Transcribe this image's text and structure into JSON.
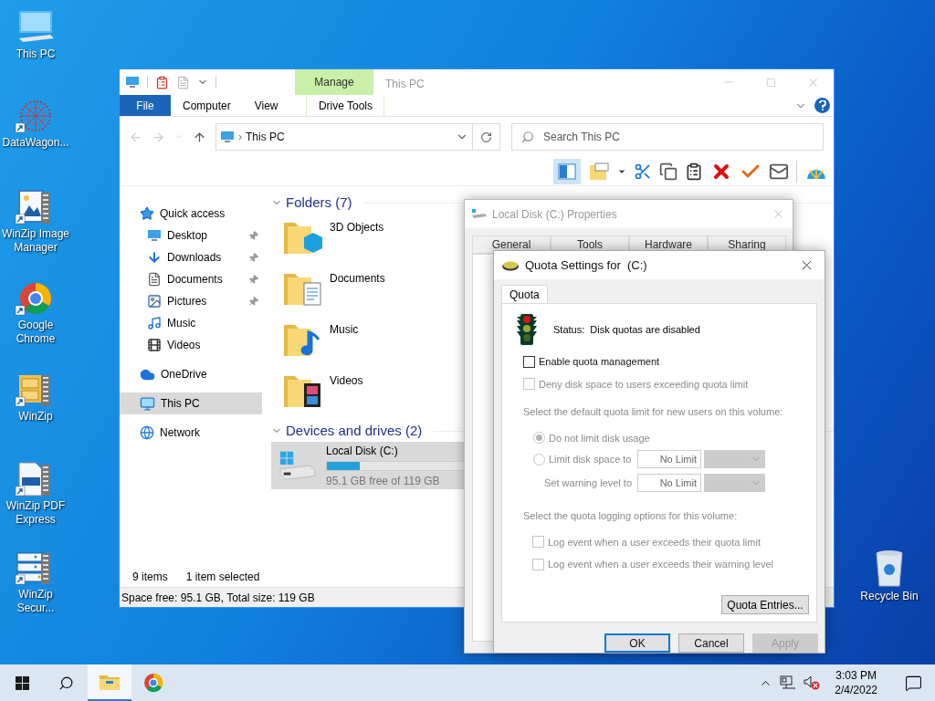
{
  "desktop_icons": [
    {
      "label": "This PC"
    },
    {
      "label": "DataWagon..."
    },
    {
      "label": "WinZip Image Manager"
    },
    {
      "label": "Google Chrome"
    },
    {
      "label": "WinZip"
    },
    {
      "label": "WinZip PDF Express"
    },
    {
      "label": "WinZip Secur..."
    }
  ],
  "recycle_bin": {
    "label": "Recycle Bin"
  },
  "explorer": {
    "title": "This PC",
    "ribbon_group": "Manage",
    "tabs": [
      {
        "label": "File",
        "selected": false
      },
      {
        "label": "Computer",
        "selected": false
      },
      {
        "label": "View",
        "selected": false
      },
      {
        "label": "Drive Tools",
        "selected": false
      }
    ],
    "address": "This PC",
    "address_separator": "›",
    "search": {
      "placeholder": "Search This PC"
    },
    "nav": [
      {
        "label": "Quick access",
        "selected": false,
        "children": [
          {
            "label": "Desktop",
            "pinned": true
          },
          {
            "label": "Downloads",
            "pinned": true
          },
          {
            "label": "Documents",
            "pinned": true
          },
          {
            "label": "Pictures",
            "pinned": true
          },
          {
            "label": "Music",
            "pinned": false
          },
          {
            "label": "Videos",
            "pinned": false
          }
        ]
      },
      {
        "label": "OneDrive",
        "selected": false
      },
      {
        "label": "This PC",
        "selected": true
      },
      {
        "label": "Network",
        "selected": false
      }
    ],
    "folders": {
      "heading": "Folders (7)",
      "items": [
        {
          "label": "3D Objects"
        },
        {
          "label": "Documents"
        },
        {
          "label": "Music"
        },
        {
          "label": "Videos"
        }
      ]
    },
    "drives": {
      "heading": "Devices and drives (2)",
      "items": [
        {
          "label": "Local Disk (C:)",
          "level": 0.2,
          "free": "95.1 GB free of 119 GB",
          "selected": true
        }
      ]
    },
    "status": {
      "count": "9 items",
      "selection": "1 item selected"
    },
    "details_bar": "Space free: 95.1 GB, Total size: 119 GB"
  },
  "properties": {
    "title": "Local Disk (C:) Properties",
    "tabs": [
      "General",
      "Tools",
      "Hardware",
      "Sharing"
    ]
  },
  "quota": {
    "title": "Quota Settings for  (C:)",
    "tab": "Quota",
    "status": "Status:  Disk quotas are disabled",
    "enable": {
      "label": "Enable quota management",
      "checked": false,
      "disabled": false
    },
    "deny": {
      "label": "Deny disk space to users exceeding quota limit",
      "checked": false,
      "disabled": true
    },
    "limit_heading": "Select the default quota limit for new users on this volume:",
    "no_limit": {
      "label": "Do not limit disk usage",
      "selected": true,
      "disabled": true
    },
    "limit": {
      "label": "Limit disk space to",
      "selected": false,
      "disabled": true,
      "value": "No Limit"
    },
    "warning": {
      "label": "Set warning level to",
      "value": "No Limit"
    },
    "logging_heading": "Select the quota logging options for this volume:",
    "log_options": [
      {
        "label": "Log event when a user exceeds their quota limit",
        "checked": false,
        "disabled": true
      },
      {
        "label": "Log event when a user exceeds their warning level",
        "checked": false,
        "disabled": true
      }
    ],
    "entries_button": "Quota Entries...",
    "buttons": [
      {
        "label": "OK",
        "disabled": false,
        "default": true
      },
      {
        "label": "Cancel",
        "disabled": false,
        "default": false
      },
      {
        "label": "Apply",
        "disabled": true,
        "default": false
      }
    ]
  },
  "taskbar": {
    "time": "3:03 PM",
    "date": "2/4/2022"
  }
}
